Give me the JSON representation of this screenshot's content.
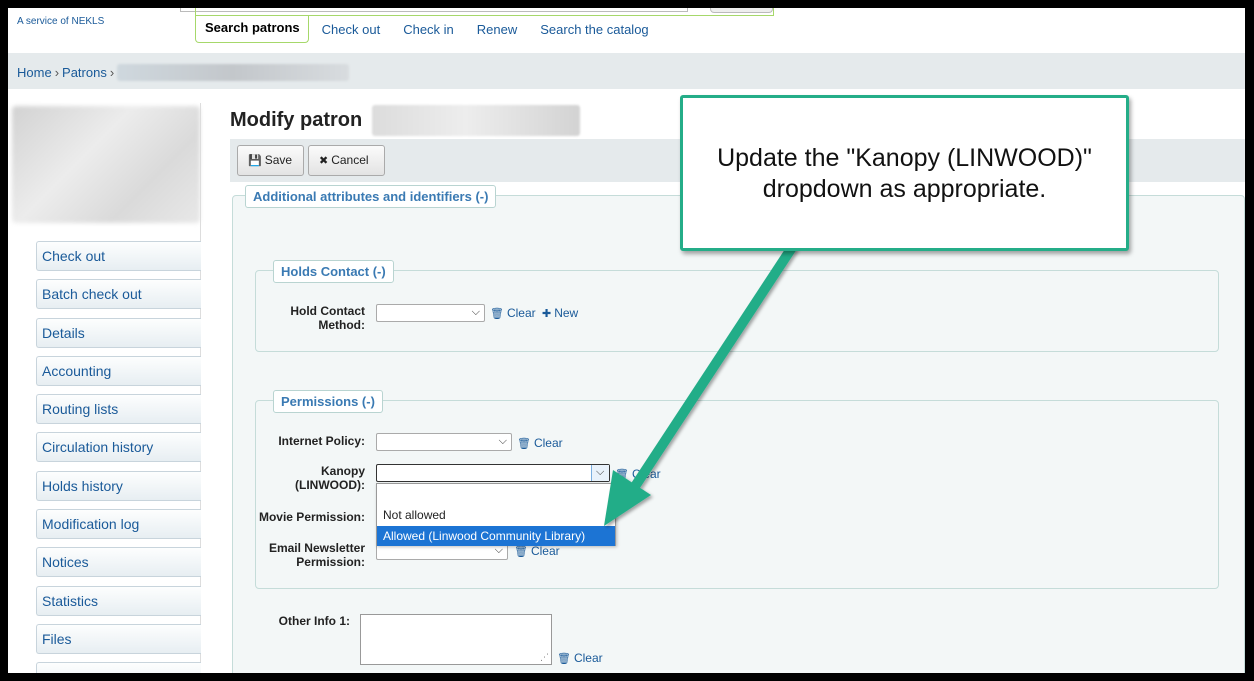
{
  "header": {
    "tagline": "A service of NEKLS",
    "tabs": [
      {
        "label": "Search patrons",
        "active": true
      },
      {
        "label": "Check out"
      },
      {
        "label": "Check in"
      },
      {
        "label": "Renew"
      },
      {
        "label": "Search the catalog"
      }
    ]
  },
  "breadcrumb": {
    "home": "Home",
    "patrons": "Patrons",
    "sep": "›"
  },
  "sidebar": {
    "items": [
      {
        "label": "Check out"
      },
      {
        "label": "Batch check out"
      },
      {
        "label": "Details"
      },
      {
        "label": "Accounting"
      },
      {
        "label": "Routing lists"
      },
      {
        "label": "Circulation history"
      },
      {
        "label": "Holds history"
      },
      {
        "label": "Modification log"
      },
      {
        "label": "Notices"
      },
      {
        "label": "Statistics"
      },
      {
        "label": "Files"
      }
    ]
  },
  "main": {
    "title": "Modify patron",
    "toolbar": {
      "save_label": "Save",
      "cancel_label": "Cancel"
    },
    "sections": {
      "additional": "Additional attributes and identifiers (-)",
      "holds_contact": "Holds Contact (-)",
      "permissions": "Permissions (-)"
    },
    "fields": {
      "hold_contact_method": {
        "label_line1": "Hold Contact",
        "label_line2": "Method:",
        "value": ""
      },
      "internet_policy": {
        "label": "Internet Policy:",
        "value": ""
      },
      "kanopy": {
        "label_line1": "Kanopy",
        "label_line2": "(LINWOOD):",
        "value": ""
      },
      "movie_permission": {
        "label": "Movie Permission:"
      },
      "email_newsletter": {
        "label_line1": "Email Newsletter",
        "label_line2": "Permission:"
      },
      "other_info_1": {
        "label": "Other Info 1:",
        "value": ""
      }
    },
    "kanopy_options": [
      {
        "label": "",
        "selected": false
      },
      {
        "label": "Not allowed",
        "selected": false
      },
      {
        "label": "Allowed (Linwood Community Library)",
        "selected": true
      }
    ],
    "clear_label": "Clear",
    "new_label": "New"
  },
  "callout": {
    "line1": "Update the \"Kanopy (LINWOOD)\"",
    "line2": "dropdown as appropriate.",
    "color": "#24ad88"
  },
  "colors": {
    "link": "#1a5a99",
    "accent_green": "#a6d86a",
    "selection_blue": "#1c74d4"
  }
}
